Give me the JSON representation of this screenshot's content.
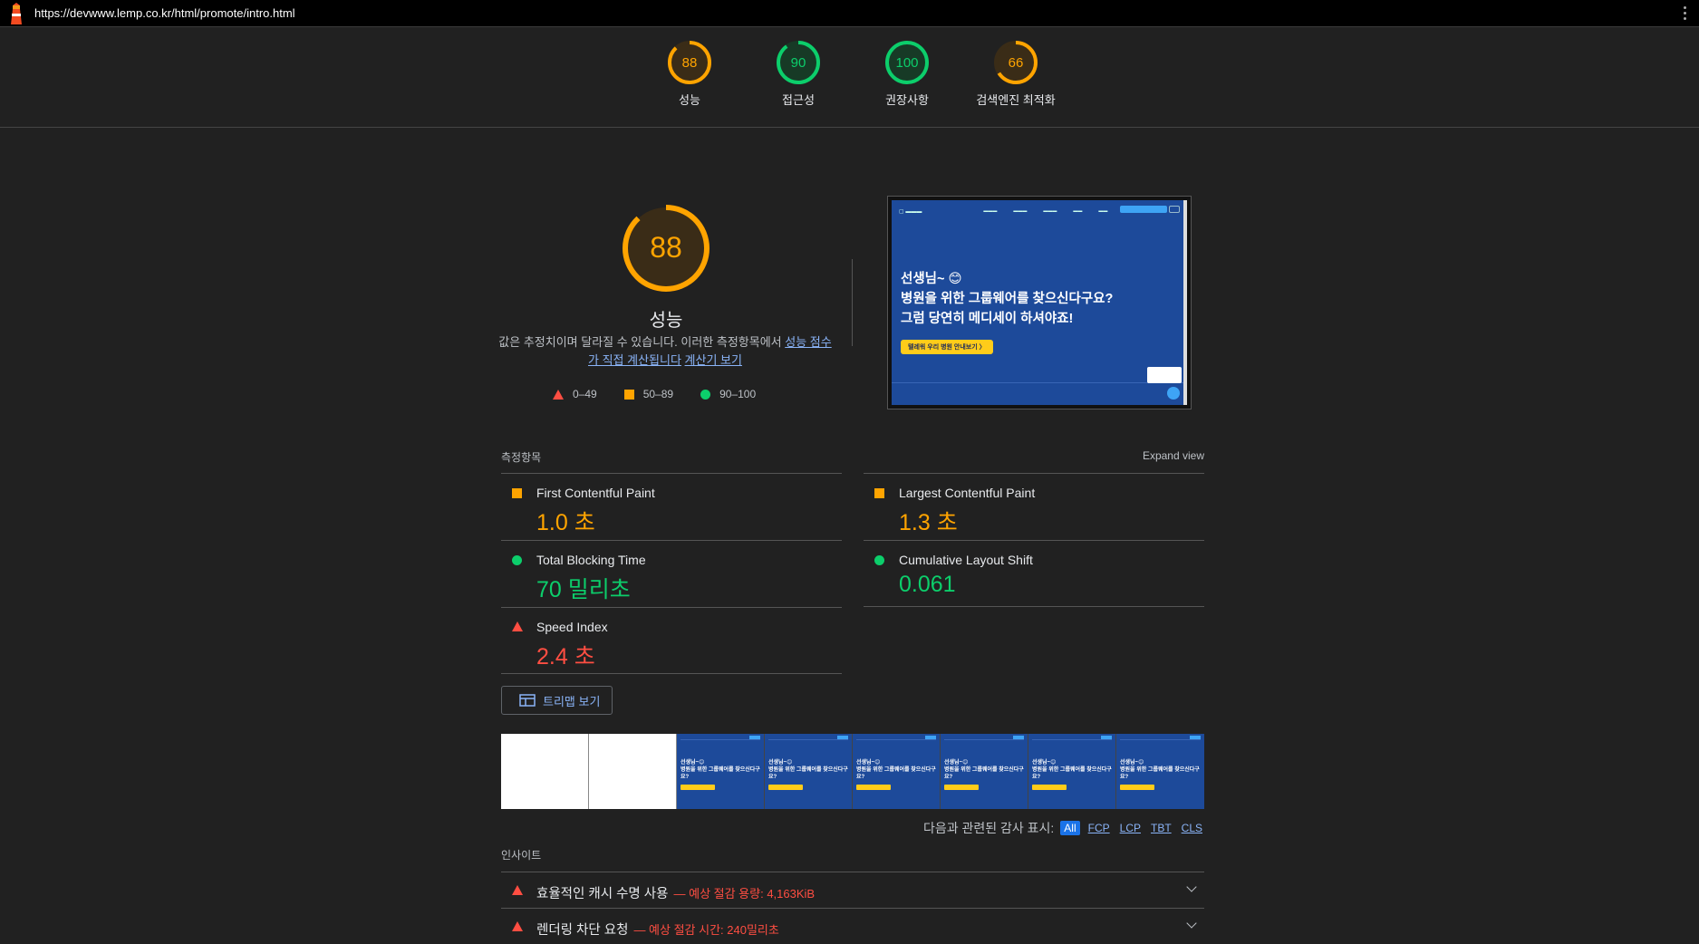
{
  "url": "https://devwww.lemp.co.kr/html/promote/intro.html",
  "colors": {
    "orange": "#ffa400",
    "green": "#0cce6b",
    "red": "#ff4e42",
    "link": "#8ab4f8"
  },
  "summary": [
    {
      "score": "88",
      "label": "성능",
      "status": "average"
    },
    {
      "score": "90",
      "label": "접근성",
      "status": "pass"
    },
    {
      "score": "100",
      "label": "권장사항",
      "status": "pass"
    },
    {
      "score": "66",
      "label": "검색엔진 최적화",
      "status": "average"
    }
  ],
  "performance": {
    "score": "88",
    "title": "성능",
    "desc_prefix": "값은 추정치이며 달라질 수 있습니다. 이러한 측정항목에서 ",
    "desc_link": "성능 점수가 직접 계산됩니다",
    "desc_link2": "계산기 보기",
    "legend": [
      "0–49",
      "50–89",
      "90–100"
    ]
  },
  "screenshot": {
    "headline_1": "선생님~ 😊",
    "headline_2": "병원을 위한 그룹웨어를 찾으신다구요?",
    "headline_3": "그럼 당연히 메디세이 하셔야죠!",
    "button": "텔레워 우리 병원 안내보기  〉"
  },
  "metrics_header": {
    "title": "측정항목",
    "expand": "Expand view"
  },
  "metrics": [
    {
      "name": "First Contentful Paint",
      "value": "1.0 초",
      "status": "average"
    },
    {
      "name": "Largest Contentful Paint",
      "value": "1.3 초",
      "status": "average"
    },
    {
      "name": "Total Blocking Time",
      "value": "70 밀리초",
      "status": "pass"
    },
    {
      "name": "Cumulative Layout Shift",
      "value": "0.061",
      "status": "pass"
    },
    {
      "name": "Speed Index",
      "value": "2.4 초",
      "status": "fail"
    }
  ],
  "treemap_label": "트리맵 보기",
  "filmstrip_text": [
    "선생님~😊",
    "병원을 위한 그룹웨어를 찾으신다구요?"
  ],
  "filter": {
    "label": "다음과 관련된 감사 표시:",
    "chips": [
      "All",
      "FCP",
      "LCP",
      "TBT",
      "CLS"
    ]
  },
  "insights_title": "인사이트",
  "audits": [
    {
      "title": "효율적인 캐시 수명 사용",
      "savings": "— 예상 절감 용량: 4,163KiB"
    },
    {
      "title": "렌더링 차단 요청",
      "savings": "— 예상 절감 시간: 240밀리초"
    }
  ]
}
